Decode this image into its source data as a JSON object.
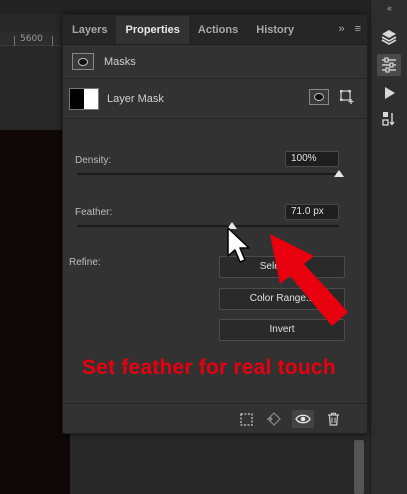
{
  "ruler": {
    "label": "5600"
  },
  "tabs": [
    {
      "label": "Layers",
      "active": false
    },
    {
      "label": "Properties",
      "active": true
    },
    {
      "label": "Actions",
      "active": false
    },
    {
      "label": "History",
      "active": false
    }
  ],
  "tab_menu": {
    "expand": "»",
    "menu": "≡"
  },
  "dock": {
    "collapse": "«"
  },
  "section": {
    "title": "Masks"
  },
  "layer_mask": {
    "label": "Layer Mask"
  },
  "density": {
    "label": "Density:",
    "value": "100%",
    "fraction": 1.0
  },
  "feather": {
    "label": "Feather:",
    "value": "71.0 px",
    "fraction": 0.59
  },
  "refine": {
    "label": "Refine:",
    "buttons": {
      "select_and_mask": "Select a...",
      "color_range": "Color Range...",
      "invert": "Invert"
    }
  },
  "annotation": {
    "text": "Set feather for real touch",
    "color": "#e8000f"
  },
  "icons": {
    "layers": "layers-icon",
    "properties": "sliders-icon",
    "actions": "play-icon",
    "history": "history-icon",
    "selection": "dashed-selection-icon",
    "apply_mask": "apply-mask-icon",
    "visibility": "eye-icon",
    "delete": "trash-icon"
  }
}
